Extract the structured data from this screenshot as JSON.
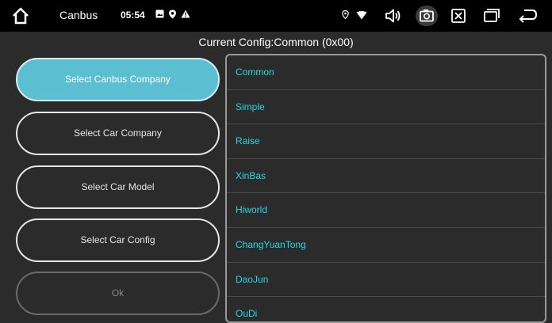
{
  "statusbar": {
    "app_title": "Canbus",
    "time": "05:54"
  },
  "header": {
    "title": "Current Config:Common (0x00)"
  },
  "buttons": {
    "canbus_company": "Select Canbus Company",
    "car_company": "Select Car Company",
    "car_model": "Select Car Model",
    "car_config": "Select Car Config",
    "ok": "Ok"
  },
  "list": {
    "items": [
      "Common",
      "Simple",
      "Raise",
      "XinBas",
      "Hiworld",
      "ChangYuanTong",
      "DaoJun",
      "OuDi"
    ]
  },
  "colors": {
    "accent": "#5bbfd1",
    "list_text": "#29d6e4",
    "background": "#2b2b2b",
    "statusbar": "#000000"
  }
}
